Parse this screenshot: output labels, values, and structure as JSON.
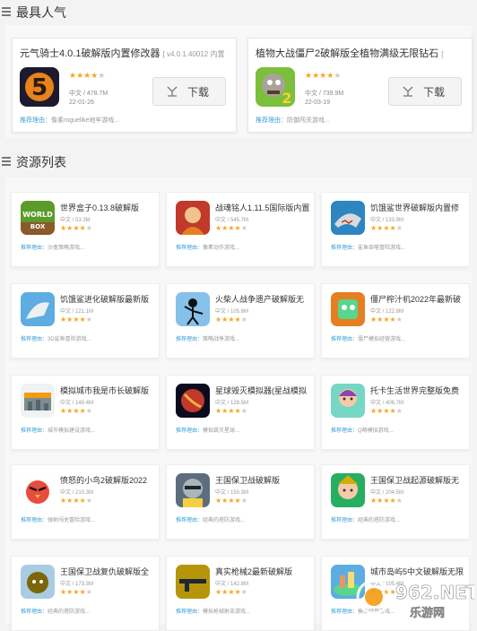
{
  "popular": {
    "title": "最具人气",
    "download_label": "下载",
    "reason_label": "推荐理由：",
    "items": [
      {
        "name": "元气骑士4.0.1破解版内置修改器",
        "version": "[ v4.0.1.40012 内置",
        "lang_size": "中文 / 478.7M",
        "date": "22-01-26",
        "rating": 4,
        "reason": "像素roguelike地牢游戏..."
      },
      {
        "name": "植物大战僵尸2破解版全植物满级无限钻石",
        "version": "[",
        "lang_size": "中文 / 739.9M",
        "date": "22-03-19",
        "rating": 4,
        "reason": "防御闯关游戏..."
      }
    ]
  },
  "resources": {
    "title": "资源列表",
    "reason_label": "推荐理由：",
    "items": [
      {
        "name": "世界盒子0.13.8破解版",
        "lang_size": "中文 / 53.3M",
        "rating": 4,
        "reason": "沙盒策略游戏..."
      },
      {
        "name": "战魂铭人1.11.5国际版内置",
        "lang_size": "中文 / 545.7M",
        "rating": 4,
        "reason": "像素动作游戏..."
      },
      {
        "name": "饥饿鲨世界破解版内置修",
        "lang_size": "中文 / 133.9M",
        "rating": 4,
        "reason": "鲨鱼吞噬冒险游戏..."
      },
      {
        "name": "饥饿鲨进化破解版最新版",
        "lang_size": "中文 / 121.1M",
        "rating": 4,
        "reason": "3D鲨鱼冒险游戏..."
      },
      {
        "name": "火柴人战争遗产破解版无",
        "lang_size": "中文 / 105.6M",
        "rating": 4,
        "reason": "策略战争游戏..."
      },
      {
        "name": "僵尸榨汁机2022年最新破",
        "lang_size": "中文 / 122.8M",
        "rating": 4,
        "reason": "僵尸模拟经营游戏..."
      },
      {
        "name": "模拟城市我是市长破解版",
        "lang_size": "中文 / 148.4M",
        "rating": 4,
        "reason": "城市模拟建设游戏..."
      },
      {
        "name": "星球毁灭模拟器(星战模拟",
        "lang_size": "中文 / 128.5M",
        "rating": 4,
        "reason": "模拟毁灭星球..."
      },
      {
        "name": "托卡生活世界完整版免费",
        "lang_size": "中文 / 406.7M",
        "rating": 4,
        "reason": "Q萌模拟游戏..."
      },
      {
        "name": "愤怒的小鸟2破解版2022",
        "lang_size": "中文 / 210.3M",
        "rating": 4,
        "reason": "弹射闯关冒险游戏..."
      },
      {
        "name": "王国保卫战破解版",
        "lang_size": "中文 / 150.3M",
        "rating": 4,
        "reason": "经典的塔防游戏..."
      },
      {
        "name": "王国保卫战起源破解版无",
        "lang_size": "中文 / 204.5M",
        "rating": 4,
        "reason": "经典的塔防游戏..."
      },
      {
        "name": "王国保卫战复仇破解版全",
        "lang_size": "中文 / 173.3M",
        "rating": 4,
        "reason": "经典的塔防游戏..."
      },
      {
        "name": "真实枪械2最新破解版",
        "lang_size": "中文 / 142.8M",
        "rating": 4,
        "reason": "模拟枪械射击游戏..."
      },
      {
        "name": "城市岛屿5中文破解版无限",
        "lang_size": "中文 / 105.4M",
        "rating": 4,
        "reason": "模拟经营游戏..."
      }
    ]
  },
  "watermark": {
    "brand": "962.NET",
    "sub": "乐游网"
  }
}
